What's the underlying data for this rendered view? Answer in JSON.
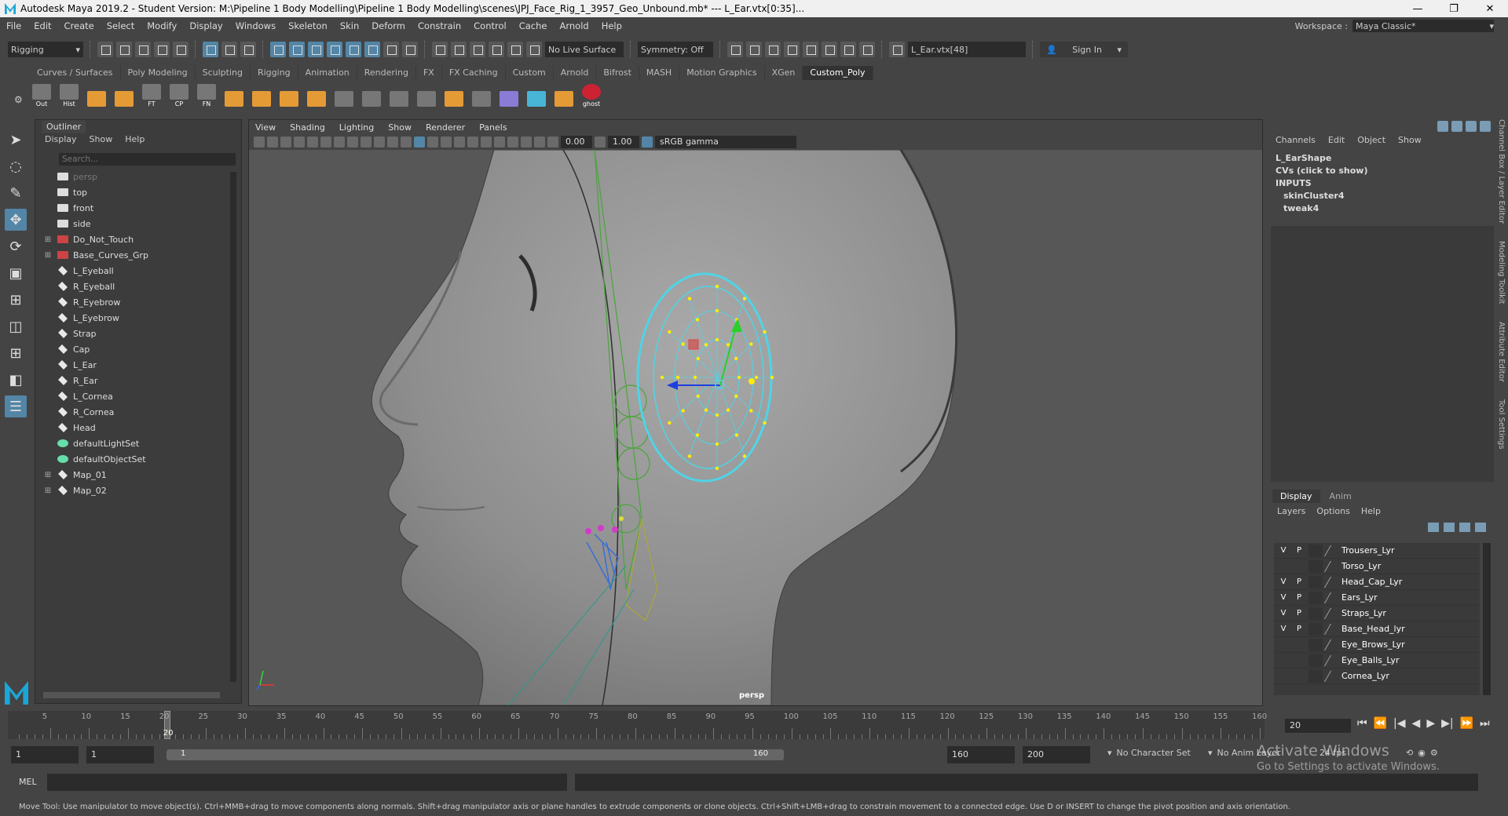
{
  "window": {
    "title": "Autodesk Maya 2019.2 - Student Version: M:\\Pipeline 1 Body Modelling\\Pipeline 1 Body Modelling\\scenes\\JPJ_Face_Rig_1_3957_Geo_Unbound.mb*   ---   L_Ear.vtx[0:35]...",
    "controls": [
      "—",
      "❐",
      "✕"
    ]
  },
  "menubar": {
    "items": [
      "File",
      "Edit",
      "Create",
      "Select",
      "Modify",
      "Display",
      "Windows",
      "Skeleton",
      "Skin",
      "Deform",
      "Constrain",
      "Control",
      "Cache",
      "Arnold",
      "Help"
    ],
    "workspace_label": "Workspace :",
    "workspace_value": "Maya Classic*"
  },
  "statusline": {
    "menuset": "Rigging",
    "live_surface": "No Live Surface",
    "symmetry": "Symmetry: Off",
    "selection_field": "L_Ear.vtx[48]",
    "sign_in": "Sign In"
  },
  "shelf": {
    "tabs": [
      "Curves / Surfaces",
      "Poly Modeling",
      "Sculpting",
      "Rigging",
      "Animation",
      "Rendering",
      "FX",
      "FX Caching",
      "Custom",
      "Arnold",
      "Bifrost",
      "MASH",
      "Motion Graphics",
      "XGen",
      "Custom_Poly"
    ],
    "active_tab": "Custom_Poly",
    "buttons": [
      {
        "label": "Out",
        "icon": "out-icon"
      },
      {
        "label": "Hist",
        "icon": "history-icon"
      },
      {
        "label": "",
        "icon": "grid-icon"
      },
      {
        "label": "",
        "icon": "grid-icon"
      },
      {
        "label": "FT",
        "icon": "freeze-transform-icon"
      },
      {
        "label": "CP",
        "icon": "center-pivot-icon"
      },
      {
        "label": "FN",
        "icon": "normals-icon"
      },
      {
        "label": "",
        "icon": "cube-icon"
      },
      {
        "label": "",
        "icon": "cube-icon"
      },
      {
        "label": "",
        "icon": "cube-icon"
      },
      {
        "label": "",
        "icon": "cube-icon"
      },
      {
        "label": "",
        "icon": "vertex-icon"
      },
      {
        "label": "",
        "icon": "edge-loop-icon"
      },
      {
        "label": "",
        "icon": "knife-icon"
      },
      {
        "label": "",
        "icon": "extrude-icon"
      },
      {
        "label": "",
        "icon": "bridge-icon"
      },
      {
        "label": "",
        "icon": "mirror-icon"
      },
      {
        "label": "",
        "icon": "lattice-icon"
      },
      {
        "label": "",
        "icon": "brush-icon"
      },
      {
        "label": "",
        "icon": "uv-icon"
      },
      {
        "label": "ghost",
        "icon": "ghost-icon"
      }
    ]
  },
  "outliner": {
    "tab": "Outliner",
    "menu": [
      "Display",
      "Show",
      "Help"
    ],
    "search_placeholder": "Search...",
    "items": [
      {
        "name": "persp",
        "type": "cam",
        "expandable": false,
        "dim": true
      },
      {
        "name": "top",
        "type": "cam",
        "expandable": false,
        "dim": false
      },
      {
        "name": "front",
        "type": "cam",
        "expandable": false,
        "dim": false
      },
      {
        "name": "side",
        "type": "cam",
        "expandable": false,
        "dim": false
      },
      {
        "name": "Do_Not_Touch",
        "type": "grp",
        "expandable": true,
        "dim": false
      },
      {
        "name": "Base_Curves_Grp",
        "type": "grp",
        "expandable": true,
        "dim": false
      },
      {
        "name": "L_Eyeball",
        "type": "mesh",
        "expandable": false,
        "dim": false
      },
      {
        "name": "R_Eyeball",
        "type": "mesh",
        "expandable": false,
        "dim": false
      },
      {
        "name": "R_Eyebrow",
        "type": "mesh",
        "expandable": false,
        "dim": false
      },
      {
        "name": "L_Eyebrow",
        "type": "mesh",
        "expandable": false,
        "dim": false
      },
      {
        "name": "Strap",
        "type": "mesh",
        "expandable": false,
        "dim": false
      },
      {
        "name": "Cap",
        "type": "mesh",
        "expandable": false,
        "dim": false
      },
      {
        "name": "L_Ear",
        "type": "mesh",
        "expandable": false,
        "dim": false
      },
      {
        "name": "R_Ear",
        "type": "mesh",
        "expandable": false,
        "dim": false
      },
      {
        "name": "L_Cornea",
        "type": "mesh",
        "expandable": false,
        "dim": false
      },
      {
        "name": "R_Cornea",
        "type": "mesh",
        "expandable": false,
        "dim": false
      },
      {
        "name": "Head",
        "type": "mesh",
        "expandable": false,
        "dim": false
      },
      {
        "name": "defaultLightSet",
        "type": "set",
        "expandable": false,
        "dim": false
      },
      {
        "name": "defaultObjectSet",
        "type": "set",
        "expandable": false,
        "dim": false
      },
      {
        "name": "Map_01",
        "type": "grp2",
        "expandable": true,
        "dim": false
      },
      {
        "name": "Map_02",
        "type": "grp2",
        "expandable": true,
        "dim": false
      }
    ]
  },
  "viewport": {
    "menu": [
      "View",
      "Shading",
      "Lighting",
      "Show",
      "Renderer",
      "Panels"
    ],
    "exposure": "0.00",
    "gamma": "1.00",
    "color_space": "sRGB gamma",
    "camera_label": "persp"
  },
  "channelbox": {
    "menu": [
      "Channels",
      "Edit",
      "Object",
      "Show"
    ],
    "shape": "L_EarShape",
    "cvs": "CVs (click to show)",
    "inputs_label": "INPUTS",
    "inputs": [
      "skinCluster4",
      "tweak4"
    ]
  },
  "side_tabs": [
    "Channel Box / Layer Editor",
    "Modeling Toolkit",
    "Attribute Editor",
    "Tool Settings"
  ],
  "layer_editor": {
    "tabs": [
      "Display",
      "Anim"
    ],
    "active_tab": "Display",
    "menu": [
      "Layers",
      "Options",
      "Help"
    ],
    "layers": [
      {
        "name": "Trousers_Lyr",
        "v": "V",
        "p": "P"
      },
      {
        "name": "Torso_Lyr",
        "v": "",
        "p": ""
      },
      {
        "name": "Head_Cap_Lyr",
        "v": "V",
        "p": "P"
      },
      {
        "name": "Ears_Lyr",
        "v": "V",
        "p": "P"
      },
      {
        "name": "Straps_Lyr",
        "v": "V",
        "p": "P"
      },
      {
        "name": "Base_Head_lyr",
        "v": "V",
        "p": "P"
      },
      {
        "name": "Eye_Brows_Lyr",
        "v": "",
        "p": ""
      },
      {
        "name": "Eye_Balls_Lyr",
        "v": "",
        "p": ""
      },
      {
        "name": "Cornea_Lyr",
        "v": "",
        "p": ""
      }
    ]
  },
  "timeslider": {
    "ticks": [
      "5",
      "10",
      "15",
      "20",
      "25",
      "30",
      "35",
      "40",
      "45",
      "50",
      "55",
      "60",
      "65",
      "70",
      "75",
      "80",
      "85",
      "90",
      "95",
      "100",
      "105",
      "110",
      "115",
      "120",
      "125",
      "130",
      "135",
      "140",
      "145",
      "150",
      "155",
      "160"
    ],
    "current_frame": "20",
    "current_frame_field": "20",
    "play_controls": [
      "⏮",
      "⏪",
      "|◀",
      "◀",
      "▶",
      "▶|",
      "⏩",
      "⏭"
    ]
  },
  "rangebar": {
    "start": "1",
    "playback_start": "1",
    "slider_left": "1",
    "slider_right": "160",
    "playback_end": "160",
    "end": "200",
    "character_set": "No Character Set",
    "anim_layer": "No Anim Layer",
    "fps": "24 fps"
  },
  "command_line": {
    "label": "MEL"
  },
  "helpline": "Move Tool: Use manipulator to move object(s). Ctrl+MMB+drag to move components along normals. Shift+drag manipulator axis or plane handles to extrude components or clone objects. Ctrl+Shift+LMB+drag to constrain movement to a connected edge. Use D or INSERT to change the pivot position and axis orientation.",
  "watermark": {
    "line1": "Activate Windows",
    "line2": "Go to Settings to activate Windows."
  },
  "colors": {
    "accent": "#5285a6",
    "ui_bg": "#444444",
    "field_bg": "#2b2b2b",
    "wire_selected": "#4fd4e6",
    "vertex": "#ffff00",
    "joint_green": "#4aa53a"
  }
}
